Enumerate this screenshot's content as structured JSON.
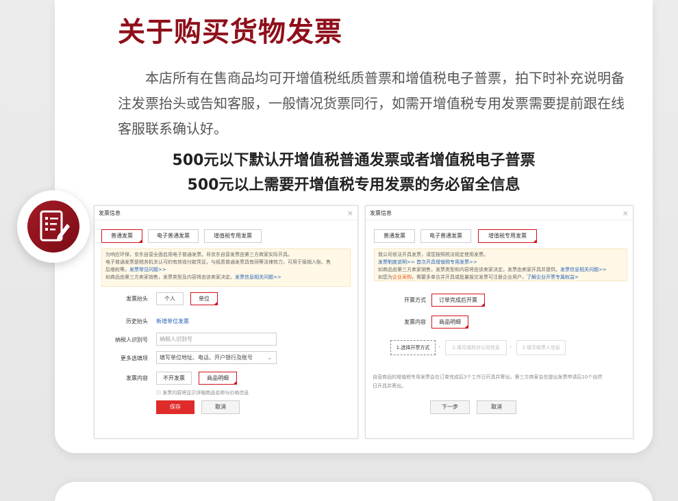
{
  "title": "关于购买货物发票",
  "intro": "本店所有在售商品均可开增值税纸质普票和增值税电子普票，拍下时补充说明备注发票抬头或告知客服，一般情况货票同行，如需开增值税专用发票需要提前跟在线客服联系确认好。",
  "line1": "500元以下默认开增值税普通发票或者增值税电子普票",
  "line2": "500元以上需要开增值税专用发票的务必留全信息",
  "left_panel": {
    "header": "发票信息",
    "close": "×",
    "tabs": [
      "普通发票",
      "电子普通发票",
      "增值税专用发票"
    ],
    "notice": {
      "line1": "为响应环保，京东自营全面启用电子普通发票。非京东自营发票由第三方商家实际开具。",
      "line2": "电子普通发票是税务机关认可的有效收付款凭证，与纸质普通发票具有同等法律效力，可用于报销入账、售",
      "line3a": "后维权等。",
      "line3b": "发票常见问题>>",
      "line4a": "如商品由第三方卖家销售，发票类型及内容将由该卖家决定。",
      "line4b": "发票信息相关问题>>"
    },
    "invoice_title_label": "发票抬头",
    "invoice_title_options": [
      "个人",
      "单位"
    ],
    "history_label": "历史抬头",
    "history_link": "新增单位发票",
    "tax_id_label": "纳税人识别号",
    "tax_id_placeholder": "纳税人识别号",
    "more_label": "更多选填项",
    "more_placeholder": "填写单位地址、电话、开户银行及账号",
    "content_label": "发票内容",
    "content_options": [
      "不开发票",
      "商品明细"
    ],
    "hint": "ⓘ 发票内容将显示详细商品名称与价格信息",
    "save": "保存",
    "cancel": "取消"
  },
  "right_panel": {
    "header": "发票信息",
    "close": "×",
    "tabs": [
      "普通发票",
      "电子普通发票",
      "增值税专用发票"
    ],
    "notice": {
      "line1": "我公司依法开具发票，请您按照税法规定使用发票。",
      "line2a": "发票制度说明>>",
      "line2b": "首次开具增值税专用发票>>",
      "line3a": "如商品由第三方卖家销售，发票类型和内容将由该卖家决定，发票由卖家开具并提供。",
      "line3b": "发票信息相关问题>>",
      "line4a": "如您为",
      "line4b": "企业采购",
      "line4c": "，需要多单合并开具或批量报交发票可注册企业用户，",
      "line4d": "了解企业开票专属权益>"
    },
    "method_label": "开票方式",
    "method_option": "订单完成后开票",
    "content_label": "发票内容",
    "content_option": "商品明细",
    "steps": [
      "1.选择开票方式",
      "2.填写或核对公司信息",
      "3.填写收票人信息"
    ],
    "step_arrow": "›",
    "footer_line1": "自营商品的增值税专用发票会在订单完成后3个工作日开具并寄出，第三方商家会在提出发票申请后10个自然",
    "footer_line2": "日开具并寄出。",
    "next": "下一步",
    "cancel": "取消"
  },
  "icons": {
    "badge": "invoice-list-edit-icon"
  }
}
